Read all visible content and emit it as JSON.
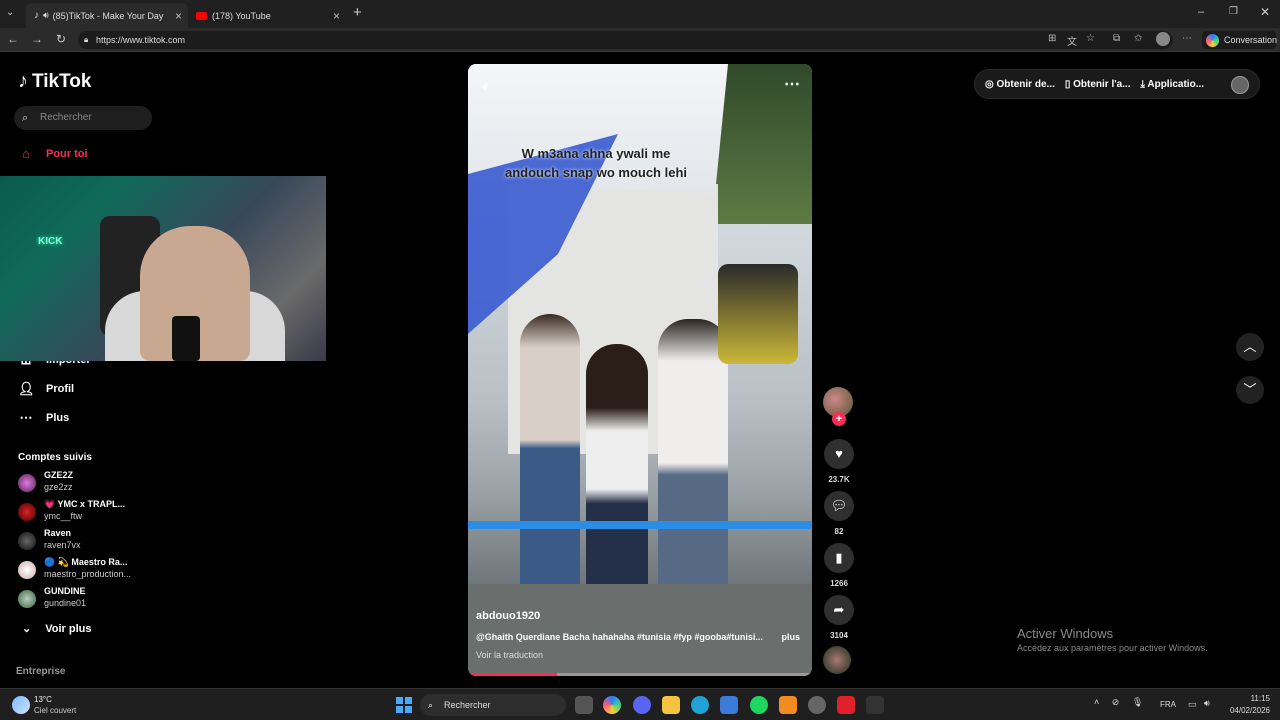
{
  "browser": {
    "tabs": [
      {
        "label": "(85)TikTok - Make Your Day",
        "active": true
      },
      {
        "label": "(178) YouTube",
        "active": false
      }
    ],
    "new_tab": "+",
    "url": "https://www.tiktok.com",
    "conversation_label": "Conversation",
    "window_controls": [
      "minimize",
      "maximize",
      "close"
    ]
  },
  "tiktok": {
    "logo_text": "TikTok",
    "search_placeholder": "Rechercher",
    "nav": {
      "for_you": "Pour toi",
      "import": "Importer",
      "profile": "Profil",
      "more": "Plus"
    },
    "following_title": "Comptes suivis",
    "accounts": [
      {
        "name": "GZE2Z",
        "handle": "gze2zz"
      },
      {
        "name": "💗 YMC x TRAPL...",
        "handle": "ymc__ftw"
      },
      {
        "name": "Raven",
        "handle": "raven7vx"
      },
      {
        "name": "🔵 💫 Maestro Ra...",
        "handle": "maestro_production..."
      },
      {
        "name": "GUNDINE",
        "handle": "gundine01"
      }
    ],
    "see_more": "Voir plus",
    "business": "Entreprise",
    "top_actions": [
      "Obtenir de...",
      "Obtenir l'a...",
      "Applicatio..."
    ],
    "video": {
      "caption": "W m3ana ahna ywali me andouch snap wo mouch lehi",
      "author": "abdouo1920",
      "description": "@Ghaith Querdiane Bacha hahahaha #tunisia #fyp #gooba#tunisi...",
      "more": "plus",
      "translate": "Voir la traduction",
      "progress": 0.26
    },
    "actions": {
      "likes": "23.7K",
      "comments": "82",
      "bookmarks": "1266",
      "shares": "3104"
    }
  },
  "watermark": {
    "line1": "Activer Windows",
    "line2": "Accédez aux paramètres pour activer Windows."
  },
  "taskbar": {
    "temperature": "13°C",
    "weather": "Ciel couvert",
    "search": "Rechercher",
    "language": "FRA",
    "time": "11:15",
    "date": "04/02/2026"
  },
  "colors": {
    "accent": "#fe2c55",
    "background": "#000000"
  }
}
